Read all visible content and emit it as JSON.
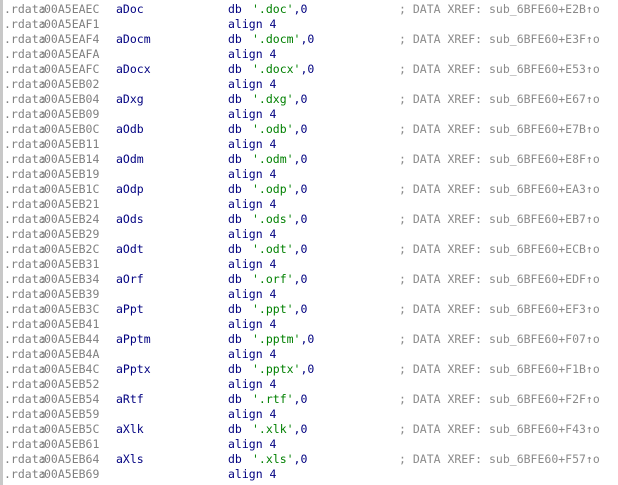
{
  "listing": [
    {
      "segment": ".rdata",
      "address": "00A5EAEC",
      "label": "aDoc",
      "mnemonic": "db",
      "string": "'.doc'",
      "tail": ",0",
      "comment": "; DATA XREF: sub_6BFE60+E2B↑o"
    },
    {
      "segment": ".rdata",
      "address": "00A5EAF1",
      "mnemonic": "align 4"
    },
    {
      "segment": ".rdata",
      "address": "00A5EAF4",
      "label": "aDocm",
      "mnemonic": "db",
      "string": "'.docm'",
      "tail": ",0",
      "comment": "; DATA XREF: sub_6BFE60+E3F↑o"
    },
    {
      "segment": ".rdata",
      "address": "00A5EAFA",
      "mnemonic": "align 4"
    },
    {
      "segment": ".rdata",
      "address": "00A5EAFC",
      "label": "aDocx",
      "mnemonic": "db",
      "string": "'.docx'",
      "tail": ",0",
      "comment": "; DATA XREF: sub_6BFE60+E53↑o"
    },
    {
      "segment": ".rdata",
      "address": "00A5EB02",
      "mnemonic": "align 4"
    },
    {
      "segment": ".rdata",
      "address": "00A5EB04",
      "label": "aDxg",
      "mnemonic": "db",
      "string": "'.dxg'",
      "tail": ",0",
      "comment": "; DATA XREF: sub_6BFE60+E67↑o"
    },
    {
      "segment": ".rdata",
      "address": "00A5EB09",
      "mnemonic": "align 4"
    },
    {
      "segment": ".rdata",
      "address": "00A5EB0C",
      "label": "aOdb",
      "mnemonic": "db",
      "string": "'.odb'",
      "tail": ",0",
      "comment": "; DATA XREF: sub_6BFE60+E7B↑o"
    },
    {
      "segment": ".rdata",
      "address": "00A5EB11",
      "mnemonic": "align 4"
    },
    {
      "segment": ".rdata",
      "address": "00A5EB14",
      "label": "aOdm",
      "mnemonic": "db",
      "string": "'.odm'",
      "tail": ",0",
      "comment": "; DATA XREF: sub_6BFE60+E8F↑o"
    },
    {
      "segment": ".rdata",
      "address": "00A5EB19",
      "mnemonic": "align 4"
    },
    {
      "segment": ".rdata",
      "address": "00A5EB1C",
      "label": "aOdp",
      "mnemonic": "db",
      "string": "'.odp'",
      "tail": ",0",
      "comment": "; DATA XREF: sub_6BFE60+EA3↑o"
    },
    {
      "segment": ".rdata",
      "address": "00A5EB21",
      "mnemonic": "align 4"
    },
    {
      "segment": ".rdata",
      "address": "00A5EB24",
      "label": "aOds",
      "mnemonic": "db",
      "string": "'.ods'",
      "tail": ",0",
      "comment": "; DATA XREF: sub_6BFE60+EB7↑o"
    },
    {
      "segment": ".rdata",
      "address": "00A5EB29",
      "mnemonic": "align 4"
    },
    {
      "segment": ".rdata",
      "address": "00A5EB2C",
      "label": "aOdt",
      "mnemonic": "db",
      "string": "'.odt'",
      "tail": ",0",
      "comment": "; DATA XREF: sub_6BFE60+ECB↑o"
    },
    {
      "segment": ".rdata",
      "address": "00A5EB31",
      "mnemonic": "align 4"
    },
    {
      "segment": ".rdata",
      "address": "00A5EB34",
      "label": "aOrf",
      "mnemonic": "db",
      "string": "'.orf'",
      "tail": ",0",
      "comment": "; DATA XREF: sub_6BFE60+EDF↑o"
    },
    {
      "segment": ".rdata",
      "address": "00A5EB39",
      "mnemonic": "align 4"
    },
    {
      "segment": ".rdata",
      "address": "00A5EB3C",
      "label": "aPpt",
      "mnemonic": "db",
      "string": "'.ppt'",
      "tail": ",0",
      "comment": "; DATA XREF: sub_6BFE60+EF3↑o"
    },
    {
      "segment": ".rdata",
      "address": "00A5EB41",
      "mnemonic": "align 4"
    },
    {
      "segment": ".rdata",
      "address": "00A5EB44",
      "label": "aPptm",
      "mnemonic": "db",
      "string": "'.pptm'",
      "tail": ",0",
      "comment": "; DATA XREF: sub_6BFE60+F07↑o"
    },
    {
      "segment": ".rdata",
      "address": "00A5EB4A",
      "mnemonic": "align 4"
    },
    {
      "segment": ".rdata",
      "address": "00A5EB4C",
      "label": "aPptx",
      "mnemonic": "db",
      "string": "'.pptx'",
      "tail": ",0",
      "comment": "; DATA XREF: sub_6BFE60+F1B↑o"
    },
    {
      "segment": ".rdata",
      "address": "00A5EB52",
      "mnemonic": "align 4"
    },
    {
      "segment": ".rdata",
      "address": "00A5EB54",
      "label": "aRtf",
      "mnemonic": "db",
      "string": "'.rtf'",
      "tail": ",0",
      "comment": "; DATA XREF: sub_6BFE60+F2F↑o"
    },
    {
      "segment": ".rdata",
      "address": "00A5EB59",
      "mnemonic": "align 4"
    },
    {
      "segment": ".rdata",
      "address": "00A5EB5C",
      "label": "aXlk",
      "mnemonic": "db",
      "string": "'.xlk'",
      "tail": ",0",
      "comment": "; DATA XREF: sub_6BFE60+F43↑o"
    },
    {
      "segment": ".rdata",
      "address": "00A5EB61",
      "mnemonic": "align 4"
    },
    {
      "segment": ".rdata",
      "address": "00A5EB64",
      "label": "aXls",
      "mnemonic": "db",
      "string": "'.xls'",
      "tail": ",0",
      "comment": "; DATA XREF: sub_6BFE60+F57↑o"
    },
    {
      "segment": ".rdata",
      "address": "00A5EB69",
      "mnemonic": "align 4"
    }
  ]
}
